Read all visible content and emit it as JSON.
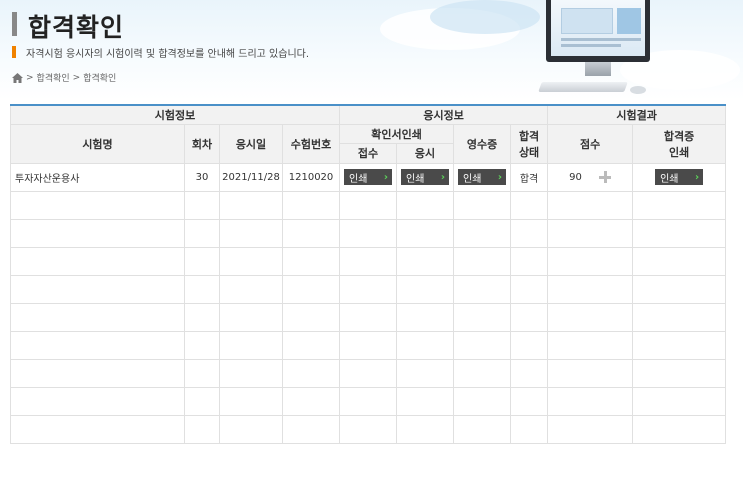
{
  "header": {
    "title": "합격확인",
    "subtitle": "자격시험 응시자의 시험이력 및 합격정보를 안내해 드리고 있습니다.",
    "breadcrumb": [
      "합격확인",
      "합격확인"
    ],
    "accent_color": "#f08200",
    "table_border_color": "#4a90c8"
  },
  "table": {
    "groups": {
      "exam_info": "시험정보",
      "apply_info": "응시정보",
      "exam_result": "시험결과"
    },
    "columns": {
      "exam_name": "시험명",
      "round": "회차",
      "exam_date": "응시일",
      "exam_number": "수험번호",
      "confirm_print": "확인서인쇄",
      "receipt_confirm": "접수",
      "apply_confirm": "응시",
      "receipt": "영수증",
      "pass_status_1": "합격",
      "pass_status_2": "상태",
      "score": "점수",
      "cert_print_1": "합격증",
      "cert_print_2": "인쇄"
    },
    "rows": [
      {
        "exam_name": "투자자산운용사",
        "round": "30",
        "exam_date": "2021/11/28",
        "exam_number": "1210020",
        "receipt_btn": "인쇄",
        "apply_btn": "인쇄",
        "receipt_doc_btn": "인쇄",
        "status": "합격",
        "score": "90",
        "cert_btn": "인쇄"
      }
    ]
  }
}
